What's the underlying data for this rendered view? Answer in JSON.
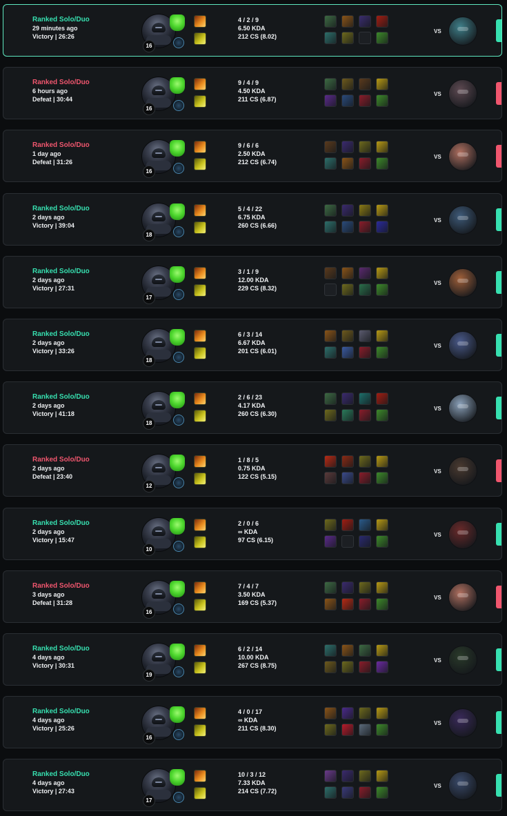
{
  "colors": {
    "victory": "#37e0b0",
    "defeat": "#f0566e",
    "card_bg": "#15181b",
    "card_border": "#2a2e33",
    "highlight_border": "#5fe8c0"
  },
  "icons": {
    "champion": "champion-portrait-icon",
    "keystone": "keystone-rune-icon",
    "secondary": "secondary-rune-icon",
    "spells": [
      "ignite-spell-icon",
      "flash-spell-icon"
    ]
  },
  "vs_label": "VS",
  "matches": [
    {
      "queue": "Ranked Solo/Duo",
      "time_ago": "29 minutes ago",
      "result": "Victory",
      "duration": "26:26",
      "level": "16",
      "kda_score": "4 / 2 / 9",
      "kda_ratio": "6.50 KDA",
      "cs": "212 CS (8.02)",
      "highlight": true,
      "opponent_color": "#3f7f89",
      "items": [
        "#3d6a43",
        "#8a5418",
        "#3a2d6e",
        "#a11d12",
        "#2d6e6a",
        "#6e6a1d",
        "",
        "#3d8a2a"
      ]
    },
    {
      "queue": "Ranked Solo/Duo",
      "time_ago": "6 hours ago",
      "result": "Defeat",
      "duration": "30:44",
      "level": "16",
      "kda_score": "9 / 4 / 9",
      "kda_ratio": "4.50 KDA",
      "cs": "211 CS (6.87)",
      "highlight": false,
      "opponent_color": "#5e4a52",
      "items": [
        "#3d6a43",
        "#6e5a1d",
        "#5a3a1d",
        "#b89a14",
        "#5a2a8a",
        "#2a4a7a",
        "#8a1d2a",
        "#3d8a2a"
      ]
    },
    {
      "queue": "Ranked Solo/Duo",
      "time_ago": "1 day ago",
      "result": "Defeat",
      "duration": "31:26",
      "level": "16",
      "kda_score": "9 / 6 / 6",
      "kda_ratio": "2.50 KDA",
      "cs": "212 CS (6.74)",
      "highlight": false,
      "opponent_color": "#b07060",
      "items": [
        "#5a3a1d",
        "#3a2a6e",
        "#6e6a1d",
        "#b89a14",
        "#2d6e6a",
        "#8a5418",
        "#8a1d2a",
        "#3d8a2a"
      ]
    },
    {
      "queue": "Ranked Solo/Duo",
      "time_ago": "2 days ago",
      "result": "Victory",
      "duration": "39:04",
      "level": "18",
      "kda_score": "5 / 4 / 22",
      "kda_ratio": "6.75 KDA",
      "cs": "260 CS (6.66)",
      "highlight": false,
      "opponent_color": "#3e5a78",
      "items": [
        "#3d6a43",
        "#3a2a6e",
        "#8a7a14",
        "#b89a14",
        "#2d6e6a",
        "#2a4a7a",
        "#8a1d2a",
        "#2a2a9a"
      ]
    },
    {
      "queue": "Ranked Solo/Duo",
      "time_ago": "2 days ago",
      "result": "Victory",
      "duration": "27:31",
      "level": "17",
      "kda_score": "3 / 1 / 9",
      "kda_ratio": "12.00 KDA",
      "cs": "229 CS (8.32)",
      "highlight": false,
      "opponent_color": "#a0603a",
      "items": [
        "#5a3a1d",
        "#8a5418",
        "#5a2a6e",
        "#b89a14",
        "",
        "#6e6a1d",
        "#2a6e4a",
        "#3d8a2a"
      ]
    },
    {
      "queue": "Ranked Solo/Duo",
      "time_ago": "2 days ago",
      "result": "Victory",
      "duration": "33:26",
      "level": "18",
      "kda_score": "6 / 3 / 14",
      "kda_ratio": "6.67 KDA",
      "cs": "201 CS (6.01)",
      "highlight": false,
      "opponent_color": "#4a5a8a",
      "items": [
        "#8a5418",
        "#6e5a1d",
        "#5a5a6e",
        "#b89a14",
        "#2d6e6a",
        "#3a5aa0",
        "#8a1d2a",
        "#3d8a2a"
      ]
    },
    {
      "queue": "Ranked Solo/Duo",
      "time_ago": "2 days ago",
      "result": "Victory",
      "duration": "41:18",
      "level": "18",
      "kda_score": "2 / 6 / 23",
      "kda_ratio": "4.17 KDA",
      "cs": "260 CS (6.30)",
      "highlight": false,
      "opponent_color": "#8aa0b8",
      "items": [
        "#3d6a43",
        "#3a2a6e",
        "#1d6e6a",
        "#a11d12",
        "#6e6a1d",
        "#2a7a5a",
        "#8a1d2a",
        "#3d8a2a"
      ]
    },
    {
      "queue": "Ranked Solo/Duo",
      "time_ago": "2 days ago",
      "result": "Defeat",
      "duration": "23:40",
      "level": "12",
      "kda_score": "1 / 8 / 5",
      "kda_ratio": "0.75 KDA",
      "cs": "122 CS (5.15)",
      "highlight": false,
      "opponent_color": "#4a3a30",
      "items": [
        "#b82a14",
        "#8a2a14",
        "#6e6a1d",
        "#b89a14",
        "#5a3a3a",
        "#3a4a8a",
        "#8a1d2a",
        "#3d8a2a"
      ]
    },
    {
      "queue": "Ranked Solo/Duo",
      "time_ago": "2 days ago",
      "result": "Victory",
      "duration": "15:47",
      "level": "10",
      "kda_score": "2 / 0 / 6",
      "kda_ratio": "∞ KDA",
      "cs": "97 CS (6.15)",
      "highlight": false,
      "opponent_color": "#6a2a2a",
      "items": [
        "#6e6a1d",
        "#a11d12",
        "#2a5a8a",
        "#b89a14",
        "#5a2a8a",
        "",
        "#2a2a6e",
        "#3d8a2a"
      ]
    },
    {
      "queue": "Ranked Solo/Duo",
      "time_ago": "3 days ago",
      "result": "Defeat",
      "duration": "31:28",
      "level": "16",
      "kda_score": "7 / 4 / 7",
      "kda_ratio": "3.50 KDA",
      "cs": "169 CS (5.37)",
      "highlight": false,
      "opponent_color": "#b07060",
      "items": [
        "#3d6a43",
        "#3a2a6e",
        "#6e6a1d",
        "#b89a14",
        "#8a5418",
        "#b82a14",
        "#8a1d2a",
        "#3d8a2a"
      ]
    },
    {
      "queue": "Ranked Solo/Duo",
      "time_ago": "4 days ago",
      "result": "Victory",
      "duration": "30:31",
      "level": "19",
      "kda_score": "6 / 2 / 14",
      "kda_ratio": "10.00 KDA",
      "cs": "267 CS (8.75)",
      "highlight": false,
      "opponent_color": "#2a3a2a",
      "items": [
        "#2d6e6a",
        "#8a5418",
        "#3d6a43",
        "#b89a14",
        "#6e5a1d",
        "#6e6a1d",
        "#8a1d2a",
        "#6a2aa0"
      ]
    },
    {
      "queue": "Ranked Solo/Duo",
      "time_ago": "4 days ago",
      "result": "Victory",
      "duration": "25:26",
      "level": "16",
      "kda_score": "4 / 0 / 17",
      "kda_ratio": "∞ KDA",
      "cs": "211 CS (8.30)",
      "highlight": false,
      "opponent_color": "#3a2a5a",
      "items": [
        "#8a5418",
        "#4a2a8a",
        "#6e6a1d",
        "#b89a14",
        "#6e6a1d",
        "#b81a2a",
        "#5a6a7a",
        "#3d8a2a"
      ]
    },
    {
      "queue": "Ranked Solo/Duo",
      "time_ago": "4 days ago",
      "result": "Victory",
      "duration": "27:43",
      "level": "17",
      "kda_score": "10 / 3 / 12",
      "kda_ratio": "7.33 KDA",
      "cs": "214 CS (7.72)",
      "highlight": false,
      "opponent_color": "#3a4a6a",
      "items": [
        "#6a3a8a",
        "#3a2a6e",
        "#6e6a1d",
        "#b89a14",
        "#2d6e6a",
        "#3a3a7a",
        "#8a1d2a",
        "#3d8a2a"
      ]
    }
  ]
}
